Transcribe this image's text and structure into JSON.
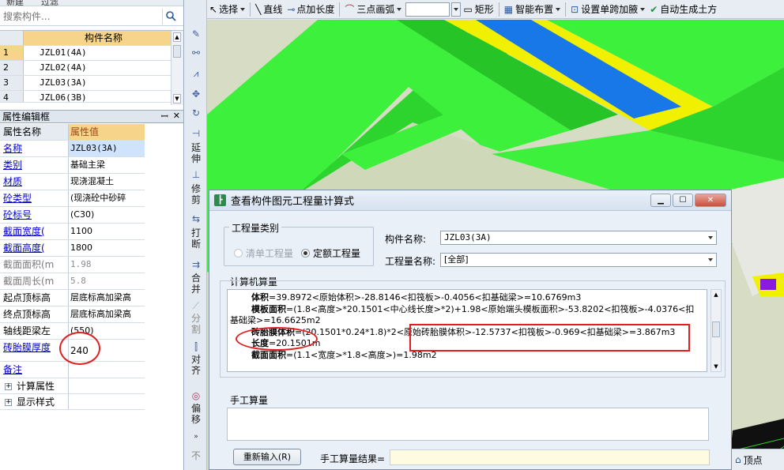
{
  "left_panel": {
    "top_strip_text": "新建　　过滤",
    "search_placeholder": "搜索构件...",
    "component_table": {
      "header": "构件名称",
      "rows": [
        {
          "num": "1",
          "name": "JZL01(4A)"
        },
        {
          "num": "2",
          "name": "JZL02(4A)"
        },
        {
          "num": "3",
          "name": "JZL03(3A)"
        },
        {
          "num": "4",
          "name": "JZL06(3B)"
        }
      ]
    },
    "property_panel": {
      "title": "属性编辑框",
      "pin_icon": "pin-icon",
      "close_icon": "close-icon",
      "header_name": "属性名称",
      "header_value": "属性值",
      "rows": [
        {
          "name": "名称",
          "value": "JZL03(3A)"
        },
        {
          "name": "类别",
          "value": "基础主梁"
        },
        {
          "name": "材质",
          "value": "现浇混凝土"
        },
        {
          "name": "砼类型",
          "value": "(现浇砼中砂碎"
        },
        {
          "name": "砼标号",
          "value": "(C30)"
        },
        {
          "name": "截面宽度(",
          "value": "1100"
        },
        {
          "name": "截面高度(",
          "value": "1800"
        },
        {
          "name": "截面面积(m",
          "value": "1.98"
        },
        {
          "name": "截面周长(m",
          "value": "5.8"
        },
        {
          "name": "起点顶标高",
          "value": "层底标高加梁高"
        },
        {
          "name": "终点顶标高",
          "value": "层底标高加梁高"
        },
        {
          "name": "轴线距梁左",
          "value": "(550)"
        },
        {
          "name": "砖胎膜厚度",
          "value": "240"
        },
        {
          "name": "备注",
          "value": ""
        },
        {
          "name": "计算属性",
          "value": ""
        },
        {
          "name": "显示样式",
          "value": ""
        }
      ]
    }
  },
  "vertical_toolbar": {
    "items": [
      {
        "label": "延伸",
        "icon": "extend-icon"
      },
      {
        "label": "修剪",
        "icon": "trim-icon"
      },
      {
        "label": "打断",
        "icon": "break-icon"
      },
      {
        "label": "合并",
        "icon": "merge-icon"
      },
      {
        "label": "分割",
        "icon": "split-icon"
      },
      {
        "label": "对齐",
        "icon": "align-icon"
      },
      {
        "label": "偏移",
        "icon": "offset-icon"
      }
    ],
    "bottom_text": "不"
  },
  "top_toolbar": {
    "select_label": "选择",
    "line_label": "直线",
    "point_length_label": "点加长度",
    "three_point_arc_label": "三点画弧",
    "rect_label": "矩形",
    "smart_layout_label": "智能布置",
    "span_haunch_label": "设置单跨加腋",
    "auto_earthwork_label": "自动生成土方"
  },
  "dialog": {
    "title": "查看构件图元工程量计算式",
    "qty_type_legend": "工程量类别",
    "qty_options": [
      {
        "label": "清单工程量",
        "selected": false,
        "disabled": true
      },
      {
        "label": "定额工程量",
        "selected": true,
        "disabled": false
      }
    ],
    "component_name_label": "构件名称:",
    "component_name_value": "JZL03(3A)",
    "qty_name_label": "工程量名称:",
    "qty_name_value": "[全部]",
    "calc_legend": "计算机算量",
    "calc_lines": [
      {
        "key": "体积",
        "expr": "=39.8972<原始体积>-28.8146<扣筏板>-0.4056<扣基础梁>=10.6769m3"
      },
      {
        "key": "模板面积",
        "expr": "=(1.8<高度>*20.1501<中心线长度>*2)+1.98<原始端头模板面积>-53.8202<扣筏板>-4.0376<扣"
      },
      {
        "key": "",
        "expr": "基础梁>=16.6625m2"
      },
      {
        "key": "砖胎膜体积",
        "expr": "=(20.1501*0.24*1.8)*2<原始砖胎膜体积>-12.5737<扣筏板>-0.969<扣基础梁>=3.867m3"
      },
      {
        "key": "长度",
        "expr": "=20.1501m"
      },
      {
        "key": "截面面积",
        "expr": "=(1.1<宽度>*1.8<高度>)=1.98m2"
      }
    ],
    "manual_legend": "手工算量",
    "redo_button": "重新输入(R)",
    "manual_result_label": "手工算量结果="
  },
  "status": {
    "vertex_label": "顶点"
  },
  "colors": {
    "beam_green": "#3cf03c",
    "slab_gray": "#cfd8b8",
    "accent_yellow": "#f0f000",
    "accent_blue": "#1878e8",
    "annotation_red": "#e02020"
  }
}
